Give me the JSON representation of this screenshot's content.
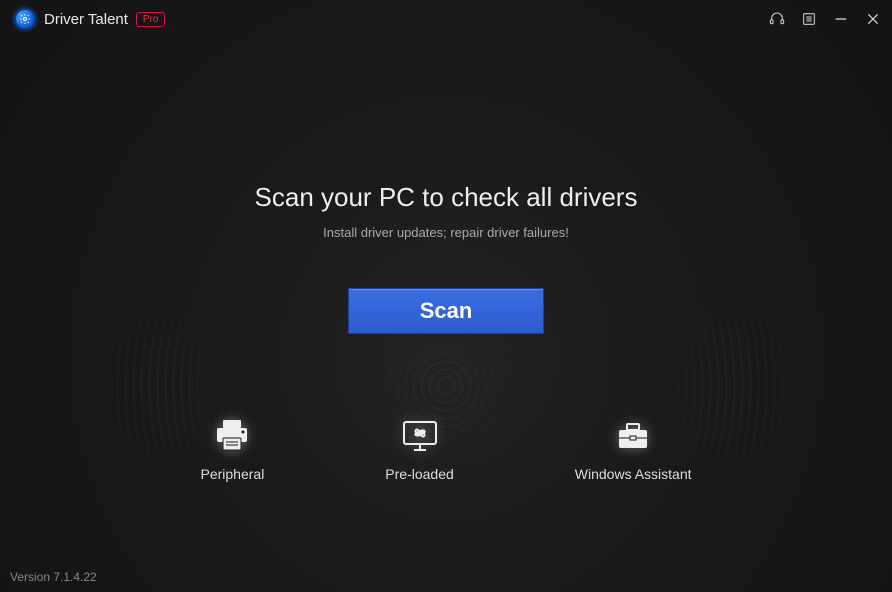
{
  "header": {
    "app_title": "Driver Talent",
    "badge": "Pro"
  },
  "main": {
    "headline": "Scan your PC to check all drivers",
    "subhead": "Install driver updates; repair driver failures!",
    "scan_label": "Scan"
  },
  "features": {
    "peripheral": {
      "label": "Peripheral"
    },
    "preloaded": {
      "label": "Pre-loaded"
    },
    "winassist": {
      "label": "Windows Assistant"
    }
  },
  "footer": {
    "version": "Version 7.1.4.22"
  }
}
